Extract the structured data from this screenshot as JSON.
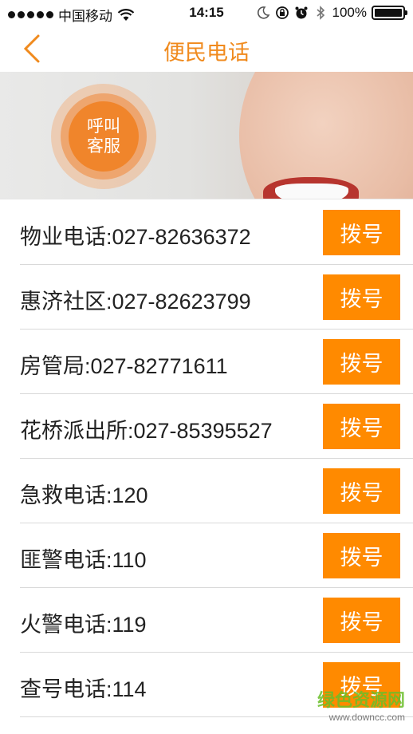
{
  "status_bar": {
    "carrier": "中国移动",
    "time": "14:15",
    "battery": "100%",
    "icons": [
      "signal-dots-icon",
      "wifi-icon",
      "moon-icon",
      "rotation-lock-icon",
      "alarm-icon",
      "bluetooth-icon",
      "battery-icon"
    ]
  },
  "nav": {
    "title": "便民电话",
    "back_icon": "chevron-left-icon"
  },
  "banner": {
    "badge_line1": "呼叫",
    "badge_line2": "客服"
  },
  "contacts": [
    {
      "label": "物业电话:027-82636372",
      "button": "拨号"
    },
    {
      "label": "惠济社区:027-82623799",
      "button": "拨号"
    },
    {
      "label": "房管局:027-82771611",
      "button": "拨号"
    },
    {
      "label": "花桥派出所:027-85395527",
      "button": "拨号"
    },
    {
      "label": "急救电话:120",
      "button": "拨号"
    },
    {
      "label": "匪警电话:110",
      "button": "拨号"
    },
    {
      "label": "火警电话:119",
      "button": "拨号"
    },
    {
      "label": "查号电话:114",
      "button": "拨号"
    }
  ],
  "watermark": {
    "main": "绿色资源网",
    "sub": "www.downcc.com"
  },
  "colors": {
    "accent": "#f08a1d",
    "button": "#ff8a00",
    "divider": "#d9d9d9"
  }
}
